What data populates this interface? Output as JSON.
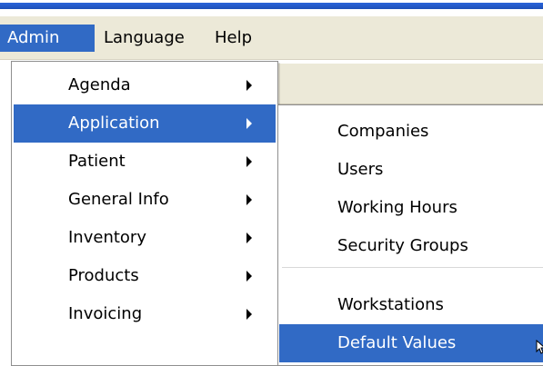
{
  "menubar": {
    "items": [
      {
        "label": "Admin"
      },
      {
        "label": "Language"
      },
      {
        "label": "Help"
      }
    ]
  },
  "admin_menu": {
    "items": [
      {
        "label": "Agenda"
      },
      {
        "label": "Application"
      },
      {
        "label": "Patient"
      },
      {
        "label": "General Info"
      },
      {
        "label": "Inventory"
      },
      {
        "label": "Products"
      },
      {
        "label": "Invoicing"
      }
    ]
  },
  "application_submenu": {
    "items": [
      {
        "label": "Companies"
      },
      {
        "label": "Users"
      },
      {
        "label": "Working Hours"
      },
      {
        "label": "Security Groups"
      },
      {
        "label": "Workstations"
      },
      {
        "label": "Default Values"
      }
    ]
  },
  "colors": {
    "selection_blue": "#316ac5",
    "menubar_gray": "#ece9d8",
    "title_blue": "#2a64da"
  },
  "icons": {
    "submenu_arrow": "chevron-right-icon",
    "cursor": "mouse-pointer-icon"
  }
}
